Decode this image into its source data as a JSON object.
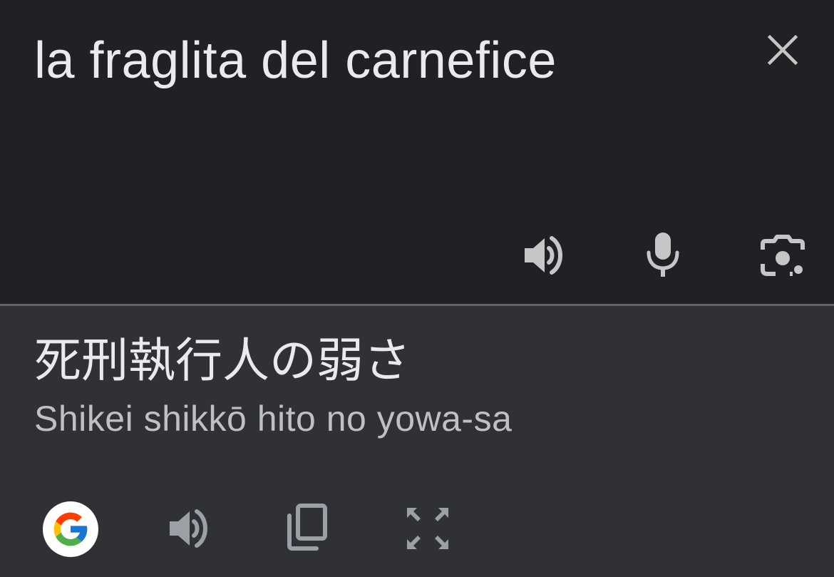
{
  "source": {
    "text": "la fraglita del carnefice",
    "icons": {
      "close": "close-icon",
      "speak": "volume-icon",
      "mic": "microphone-icon",
      "camera": "camera-lens-icon"
    }
  },
  "translation": {
    "text": "死刑執行人の弱さ",
    "romanization": "Shikei shikkō hito no yowa-sa",
    "icons": {
      "google": "google-logo-icon",
      "speak": "volume-icon",
      "copy": "copy-icon",
      "fullscreen": "fullscreen-icon"
    }
  },
  "colors": {
    "source_bg": "#202124",
    "target_bg": "#303134",
    "divider": "#5f6368",
    "primary_text": "#e8eaed",
    "secondary_text": "#bdc1c6",
    "icon_gray": "#9aa0a6",
    "icon_light": "#c4c7c5"
  }
}
